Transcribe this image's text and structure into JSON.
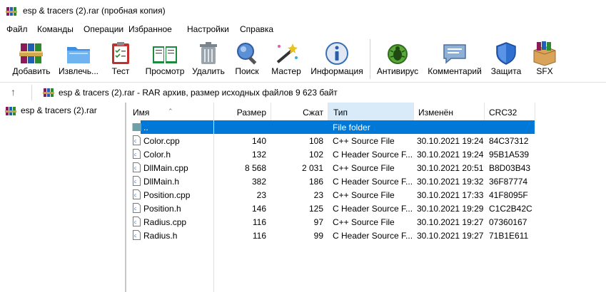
{
  "window": {
    "title": "esp & tracers (2).rar (пробная копия)"
  },
  "menu": [
    "Файл",
    "Команды",
    "Операции",
    "Избранное",
    "Настройки",
    "Справка"
  ],
  "toolbar": [
    {
      "label": "Добавить",
      "icon": "add-books-icon"
    },
    {
      "label": "Извлечь...",
      "icon": "extract-folder-icon"
    },
    {
      "label": "Тест",
      "icon": "test-clipboard-icon"
    },
    {
      "label": "Просмотр",
      "icon": "view-book-icon"
    },
    {
      "label": "Удалить",
      "icon": "trash-can-icon"
    },
    {
      "label": "Поиск",
      "icon": "magnifier-icon"
    },
    {
      "label": "Мастер",
      "icon": "magic-wand-icon"
    },
    {
      "label": "Информация",
      "icon": "info-icon"
    },
    {
      "label": "Антивирус",
      "icon": "bug-icon"
    },
    {
      "label": "Комментарий",
      "icon": "speech-bubble-icon"
    },
    {
      "label": "Защита",
      "icon": "shield-icon"
    },
    {
      "label": "SFX",
      "icon": "sfx-box-icon"
    }
  ],
  "address": {
    "text": "esp & tracers (2).rar - RAR архив, размер исходных файлов 9 623 байт"
  },
  "tree": {
    "root": "esp & tracers (2).rar"
  },
  "columns": {
    "name": "Имя",
    "size": "Размер",
    "packed": "Сжат",
    "type": "Тип",
    "modified": "Изменён",
    "crc": "CRC32"
  },
  "parent_row": {
    "name": "..",
    "type": "File folder"
  },
  "files": [
    {
      "name": "Color.cpp",
      "size": "140",
      "packed": "108",
      "type": "C++ Source File",
      "modified": "30.10.2021 19:24",
      "crc": "84C37312"
    },
    {
      "name": "Color.h",
      "size": "132",
      "packed": "102",
      "type": "C Header Source F...",
      "modified": "30.10.2021 19:24",
      "crc": "95B1A539"
    },
    {
      "name": "DllMain.cpp",
      "size": "8 568",
      "packed": "2 031",
      "type": "C++ Source File",
      "modified": "30.10.2021 20:51",
      "crc": "B8D03B43"
    },
    {
      "name": "DllMain.h",
      "size": "382",
      "packed": "186",
      "type": "C Header Source F...",
      "modified": "30.10.2021 19:32",
      "crc": "36F87774"
    },
    {
      "name": "Position.cpp",
      "size": "23",
      "packed": "23",
      "type": "C++ Source File",
      "modified": "30.10.2021 17:33",
      "crc": "41F8095F"
    },
    {
      "name": "Position.h",
      "size": "146",
      "packed": "125",
      "type": "C Header Source F...",
      "modified": "30.10.2021 19:29",
      "crc": "C1C2B42C"
    },
    {
      "name": "Radius.cpp",
      "size": "116",
      "packed": "97",
      "type": "C++ Source File",
      "modified": "30.10.2021 19:27",
      "crc": "07360167"
    },
    {
      "name": "Radius.h",
      "size": "116",
      "packed": "99",
      "type": "C Header Source F...",
      "modified": "30.10.2021 19:27",
      "crc": "71B1E611"
    }
  ]
}
